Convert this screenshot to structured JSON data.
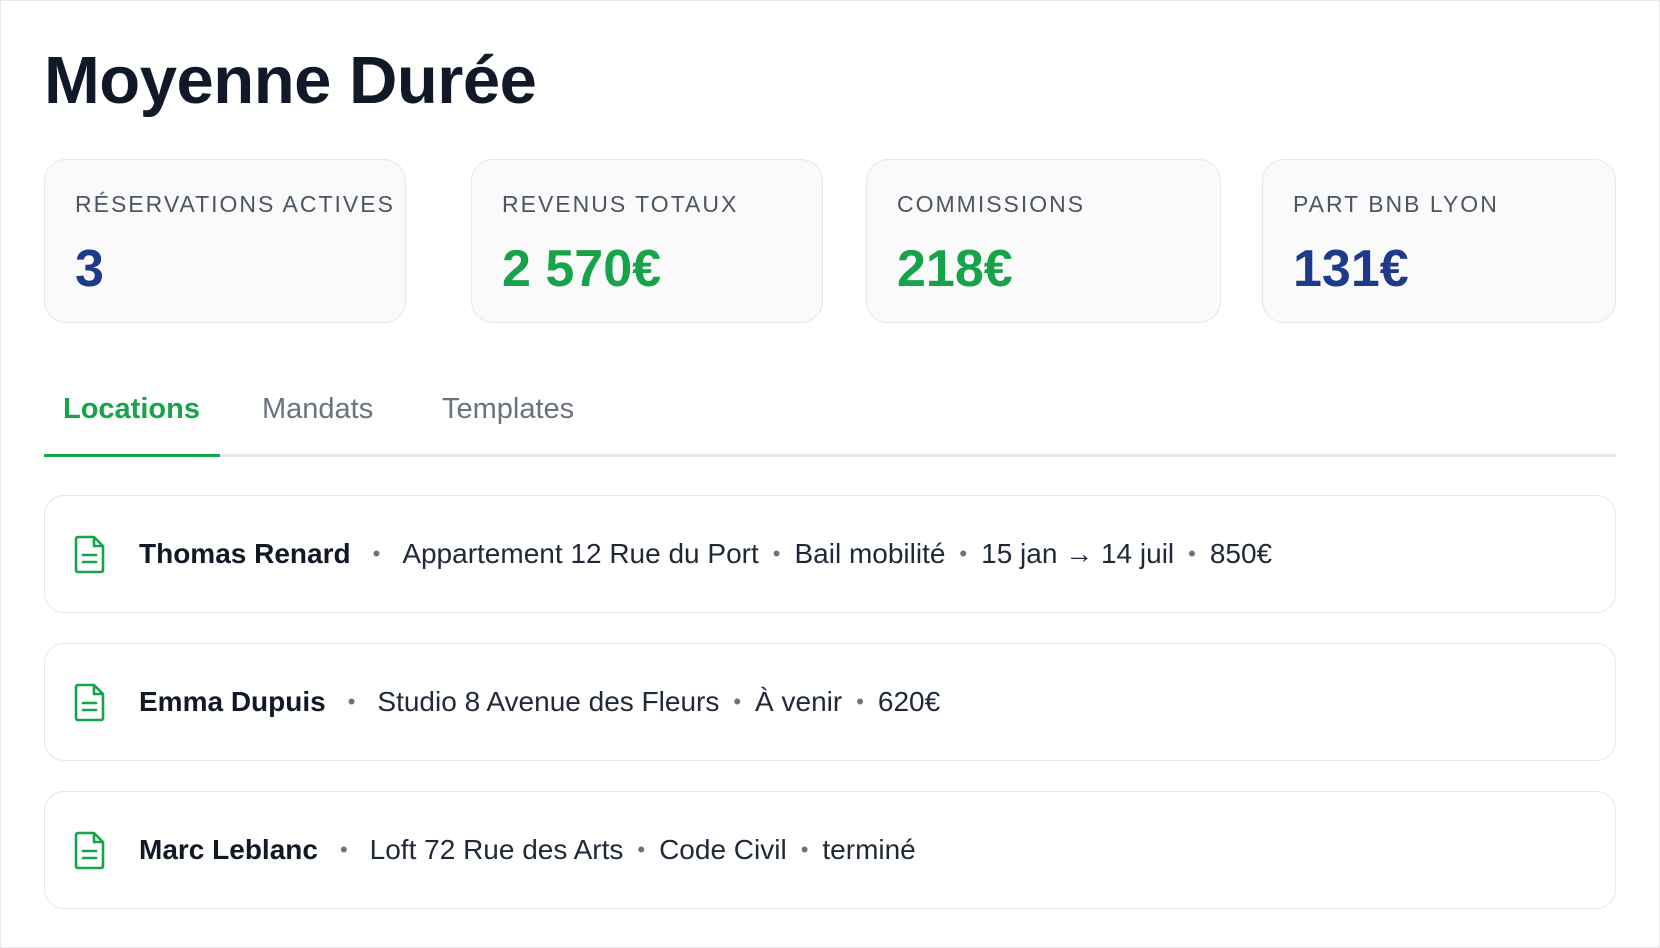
{
  "page": {
    "title": "Moyenne Durée"
  },
  "stats": [
    {
      "label": "RÉSERVATIONS ACTIVES",
      "value": "3",
      "color": "#1e3a8a"
    },
    {
      "label": "REVENUS TOTAUX",
      "value": "2 570€",
      "color": "#16a34a"
    },
    {
      "label": "COMMISSIONS",
      "value": "218€",
      "color": "#16a34a"
    },
    {
      "label": "PART BNB LYON",
      "value": "131€",
      "color": "#1e3a8a"
    }
  ],
  "tabs": [
    {
      "label": "Locations",
      "active": true
    },
    {
      "label": "Mandats",
      "active": false
    },
    {
      "label": "Templates",
      "active": false
    }
  ],
  "rentals": [
    {
      "icon": "document-icon",
      "name": "Thomas Renard",
      "property": "Appartement 12 Rue du Port",
      "contract": "Bail mobilité",
      "dates": "15 jan → 14 juil",
      "amount": "850€"
    },
    {
      "icon": "document-icon",
      "name": "Emma Dupuis",
      "property": "Studio 8 Avenue des Fleurs",
      "status": "À venir",
      "amount": "620€"
    },
    {
      "icon": "document-icon",
      "name": "Marc Leblanc",
      "property": "Loft 72 Rue des Arts",
      "contract": "Code Civil",
      "status": "terminé"
    }
  ],
  "separator": "•",
  "colors": {
    "accent_green": "#16a34a",
    "accent_navy": "#1e3a8a",
    "border": "#e5e7eb",
    "muted_text": "#6b7280"
  }
}
